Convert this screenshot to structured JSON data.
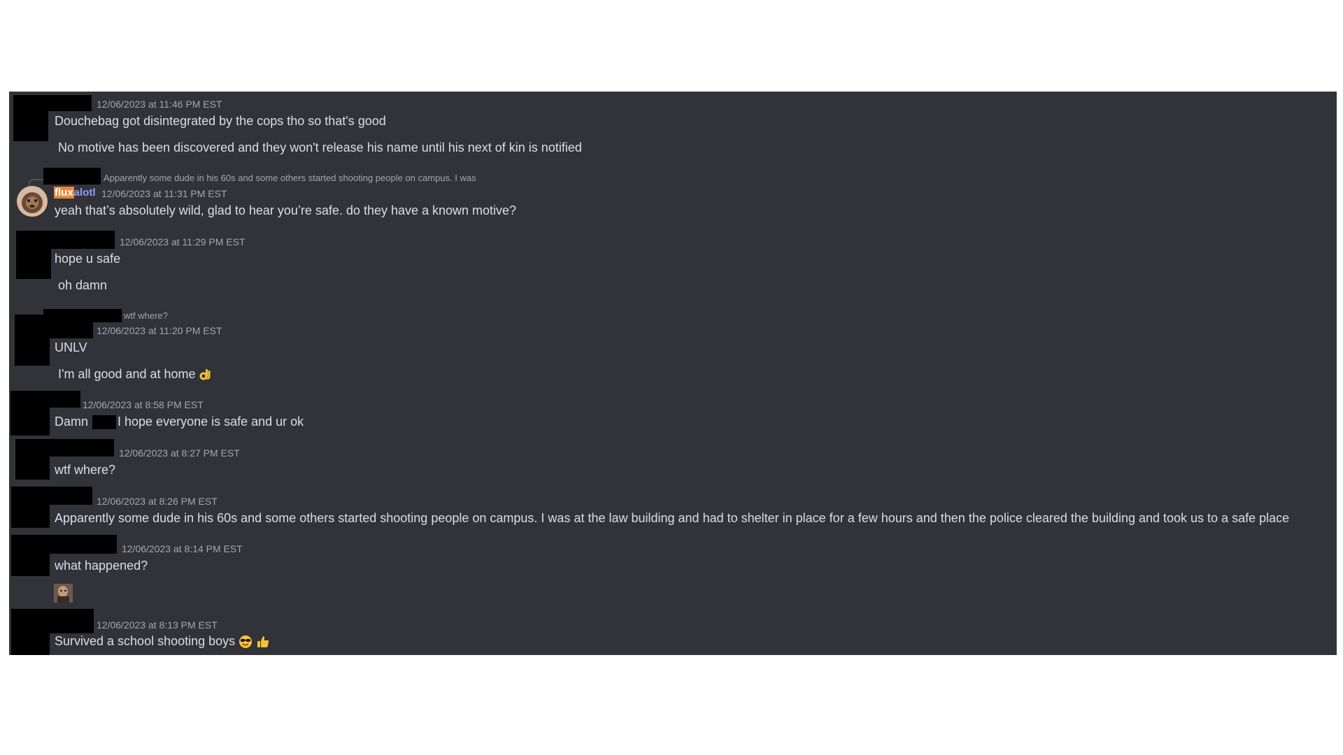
{
  "colors": {
    "background": "#313338",
    "text": "#dbdee1",
    "muted": "#a5a7ae",
    "username_highlight": "#e8873a",
    "username_accent": "#949cf7"
  },
  "messages": [
    {
      "timestamp": "12/06/2023 at 11:46 PM EST",
      "lines": [
        "Douchebag got disintegrated by the cops tho so that's good",
        "No motive has been discovered and they won't release his name until his next of kin is notified"
      ]
    },
    {
      "reply_preview": "Apparently some dude in his 60s and some others started shooting people on campus. I was",
      "username_part1": "flux",
      "username_part2": "alotl",
      "timestamp": "12/06/2023 at 11:31 PM EST",
      "lines": [
        "yeah that’s absolutely wild, glad to hear you’re safe. do they have a known motive?"
      ]
    },
    {
      "timestamp": "12/06/2023 at 11:29 PM EST",
      "lines": [
        "hope u safe",
        "oh damn"
      ]
    },
    {
      "reply_preview": "wtf where?",
      "timestamp": "12/06/2023 at 11:20 PM EST",
      "lines": [
        "UNLV",
        "I'm all good and at home"
      ],
      "emoji": "ok-hand-emoji"
    },
    {
      "timestamp": "12/06/2023 at 8:58 PM EST",
      "line_start": "Damn",
      "line_end": "I hope everyone is safe and ur ok"
    },
    {
      "timestamp": "12/06/2023 at 8:27 PM EST",
      "lines": [
        "wtf where?"
      ]
    },
    {
      "timestamp": "12/06/2023 at 8:26 PM EST",
      "lines": [
        "Apparently some dude in his 60s and some others started shooting people on campus. I was at the law building and had to shelter in place for a few hours and then the police cleared the building and took us to a safe place"
      ]
    },
    {
      "timestamp": "12/06/2023 at 8:14 PM EST",
      "lines": [
        "what happened?"
      ]
    },
    {
      "timestamp": "12/06/2023 at 8:13 PM EST",
      "lines": [
        "Survived a school shooting boys"
      ],
      "emojis": [
        "sunglasses-emoji",
        "thumbs-up-emoji"
      ]
    }
  ]
}
